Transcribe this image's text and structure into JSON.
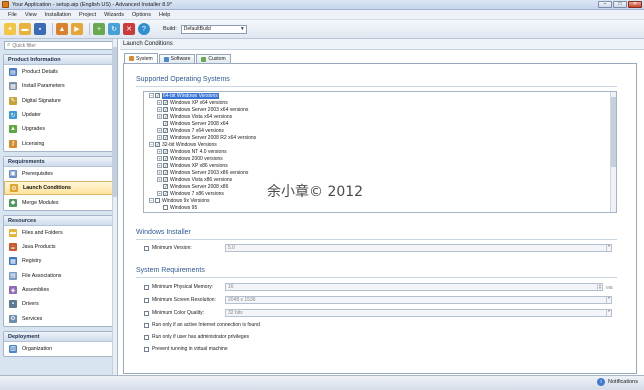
{
  "window": {
    "title": "Your Application - setup.aip (English US) - Advanced Installer 8.9*"
  },
  "menu": [
    "File",
    "View",
    "Installation",
    "Project",
    "Wizards",
    "Options",
    "Help"
  ],
  "toolbar": {
    "build_label": "Build:",
    "build_value": "DefaultBuild"
  },
  "sidebar": {
    "quick_filter_placeholder": "Quick filter",
    "groups": [
      {
        "title": "Product Information",
        "items": [
          "Product Details",
          "Install Parameters",
          "Digital Signature",
          "Updater",
          "Upgrades",
          "Licensing"
        ]
      },
      {
        "title": "Requirements",
        "items": [
          "Prerequisites",
          "Launch Conditions",
          "Merge Modules"
        ]
      },
      {
        "title": "Resources",
        "items": [
          "Files and Folders",
          "Java Products",
          "Registry",
          "File Associations",
          "Assemblies",
          "Drivers",
          "Services"
        ]
      },
      {
        "title": "Deployment",
        "items": [
          "Organization"
        ]
      }
    ]
  },
  "panel": {
    "title": "Launch Conditions"
  },
  "tabs": [
    "System",
    "Software",
    "Custom"
  ],
  "sections": {
    "os": "Supported Operating Systems",
    "wi": "Windows Installer",
    "sys": "System Requirements"
  },
  "tree": [
    {
      "label": "64-bit Windows Versions",
      "level": 0,
      "checked": true,
      "expander": "−",
      "selected": true
    },
    {
      "label": "Windows XP x64 versions",
      "level": 1,
      "checked": true,
      "expander": "+"
    },
    {
      "label": "Windows Server 2003 x64 versions",
      "level": 1,
      "checked": true,
      "expander": "+"
    },
    {
      "label": "Windows Vista x64 versions",
      "level": 1,
      "checked": true,
      "expander": "+"
    },
    {
      "label": "Windows Server 2008 x64",
      "level": 1,
      "checked": true,
      "expander": ""
    },
    {
      "label": "Windows 7 x64 versions",
      "level": 1,
      "checked": true,
      "expander": "+"
    },
    {
      "label": "Windows Server 2008 R2 x64 versions",
      "level": 1,
      "checked": true,
      "expander": "+"
    },
    {
      "label": "32-bit Windows Versions",
      "level": 0,
      "checked": true,
      "expander": "−"
    },
    {
      "label": "Windows NT 4.0 versions",
      "level": 1,
      "checked": true,
      "expander": "+"
    },
    {
      "label": "Windows 2000 versions",
      "level": 1,
      "checked": true,
      "expander": "+"
    },
    {
      "label": "Windows XP x86 versions",
      "level": 1,
      "checked": true,
      "expander": "+"
    },
    {
      "label": "Windows Server 2003 x86 versions",
      "level": 1,
      "checked": true,
      "expander": "+"
    },
    {
      "label": "Windows Vista x86 versions",
      "level": 1,
      "checked": true,
      "expander": "+"
    },
    {
      "label": "Windows Server 2008 x86",
      "level": 1,
      "checked": true,
      "expander": ""
    },
    {
      "label": "Windows 7 x86 versions",
      "level": 1,
      "checked": true,
      "expander": "+"
    },
    {
      "label": "Windows 9x Versions",
      "level": 0,
      "checked": false,
      "expander": "−"
    },
    {
      "label": "Windows 95",
      "level": 1,
      "checked": false,
      "expander": ""
    }
  ],
  "windows_installer": {
    "min_version_label": "Minimum Version:",
    "min_version_value": "5.0"
  },
  "system_requirements": {
    "physical_memory_label": "Minimum Physical Memory:",
    "physical_memory_value": "16",
    "physical_memory_unit": "MB",
    "screen_resolution_label": "Minimum Screen Resolution:",
    "screen_resolution_value": "2048 x 1536",
    "color_quality_label": "Minimum Color Quality:",
    "color_quality_value": "32 bits",
    "internet_label": "Run only if an active Internet connection is found",
    "admin_label": "Run only if user has administrator privileges",
    "virtual_label": "Prevent running in virtual machine"
  },
  "watermark": "余小章© 2012",
  "statusbar": {
    "notifications": "Notifications"
  },
  "colors": {
    "section_title": "#2e5a9a",
    "selection": "#3875d7"
  }
}
